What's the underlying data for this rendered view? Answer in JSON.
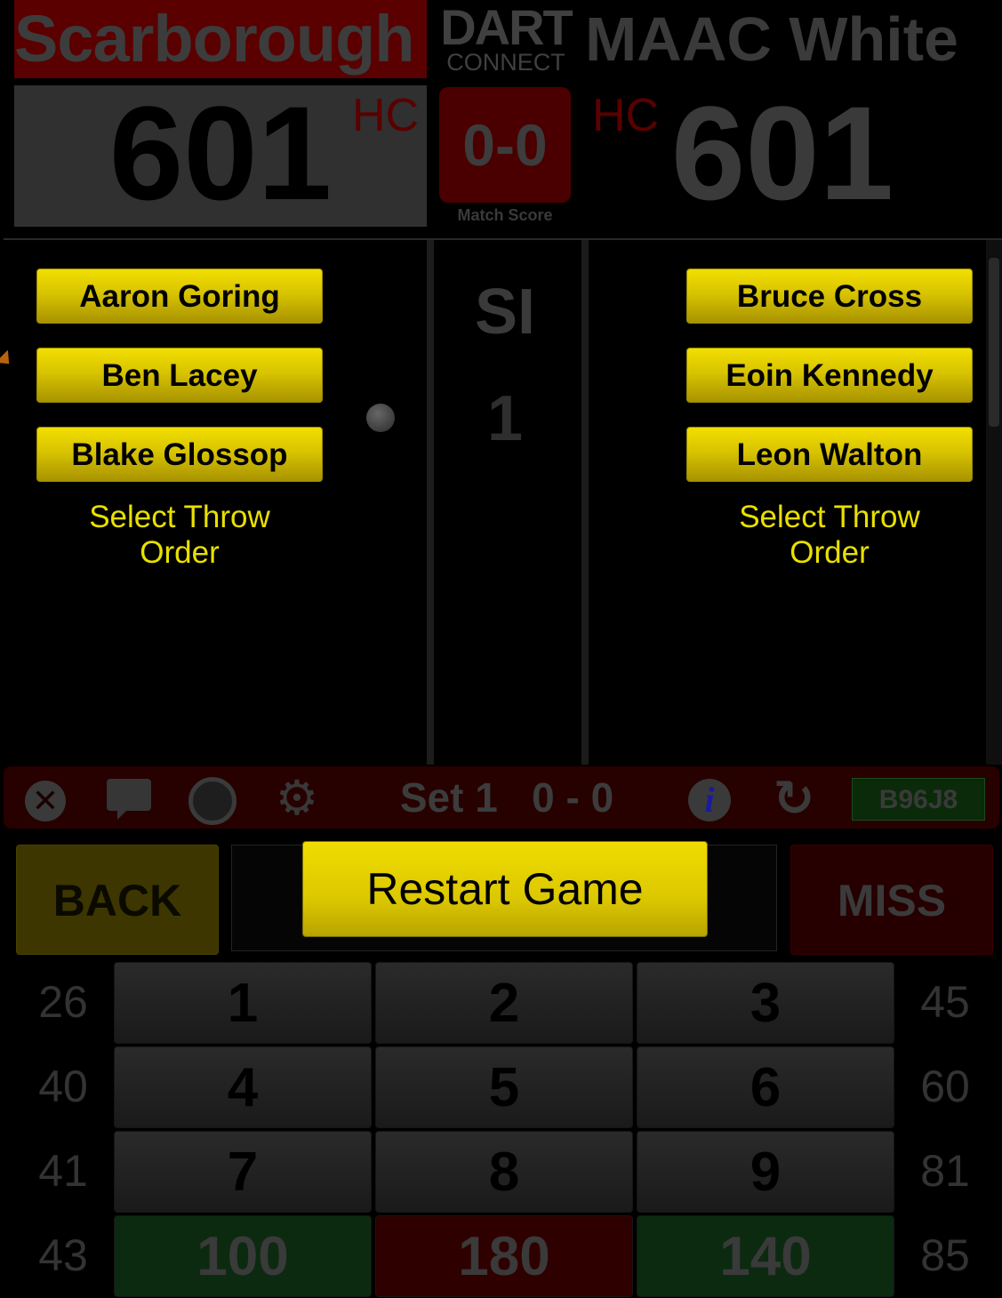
{
  "header": {
    "left_team": "Scarborough",
    "right_team": "MAAC White",
    "logo_line1": "DART",
    "logo_line2": "CONNECT",
    "left_score": "601",
    "right_score": "601",
    "left_hc": "HC",
    "right_hc": "HC",
    "match_score": "0-0",
    "match_score_label": "Match Score"
  },
  "left_players": [
    "Aaron Goring",
    "Ben Lacey",
    "Blake Glossop"
  ],
  "right_players": [
    "Bruce Cross",
    "Eoin Kennedy",
    "Leon Walton"
  ],
  "throw_order_label_line1": "Select Throw",
  "throw_order_label_line2": "Order",
  "center": {
    "si_label": "SI",
    "si_value": "1"
  },
  "toolbar": {
    "close": "✕",
    "set_text": "Set 1   0 - 0",
    "info": "i",
    "refresh": "↻",
    "code": "B96J8",
    "gear": "⚙"
  },
  "actions": {
    "back": "BACK",
    "restart": "Restart Game",
    "miss": "MISS"
  },
  "keypad": {
    "left_side": [
      "26",
      "40",
      "41",
      "43"
    ],
    "right_side": [
      "45",
      "60",
      "81",
      "85"
    ],
    "keys": [
      [
        "1",
        "2",
        "3"
      ],
      [
        "4",
        "5",
        "6"
      ],
      [
        "7",
        "8",
        "9"
      ],
      [
        "100",
        "180",
        "140"
      ]
    ]
  },
  "colors": {
    "button_yellow": "#e6d200",
    "label_yellow": "#e8e000",
    "dark_red": "#5a0000"
  }
}
